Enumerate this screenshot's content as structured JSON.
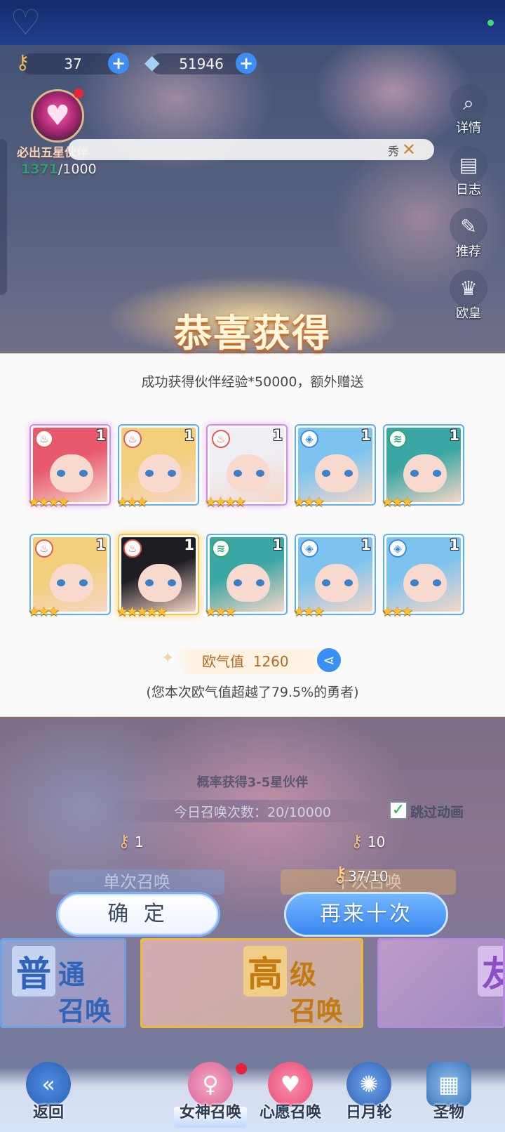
{
  "resources": {
    "keys": "37",
    "diamonds": "51946"
  },
  "pity": {
    "label": "必出五星伙伴",
    "current": "1371",
    "total": "/1000"
  },
  "marquee": {
    "text": "秀"
  },
  "side_menu": [
    {
      "label": "详情",
      "icon": "search-icon"
    },
    {
      "label": "日志",
      "icon": "book-icon"
    },
    {
      "label": "推荐",
      "icon": "feather-icon"
    },
    {
      "label": "欧皇",
      "icon": "crown-icon"
    }
  ],
  "result": {
    "title": "恭喜获得",
    "message": "成功获得伙伴经验*50000，额外赠送",
    "cards": [
      {
        "level": "1",
        "stars": 4,
        "element": "fire",
        "frame": "purple",
        "hair": "#e8596e"
      },
      {
        "level": "1",
        "stars": 3,
        "element": "fire",
        "frame": "blue",
        "hair": "#f2cf7a"
      },
      {
        "level": "1",
        "stars": 4,
        "element": "fire",
        "frame": "purple",
        "hair": "#eeeef4"
      },
      {
        "level": "1",
        "stars": 3,
        "element": "water",
        "frame": "blue",
        "hair": "#7cc4ef"
      },
      {
        "level": "1",
        "stars": 3,
        "element": "wind",
        "frame": "blue",
        "hair": "#3aa7a4"
      },
      {
        "level": "1",
        "stars": 3,
        "element": "fire",
        "frame": "blue",
        "hair": "#f2cf7a"
      },
      {
        "level": "1",
        "stars": 5,
        "element": "fire",
        "frame": "gold",
        "hair": "#1f1d24"
      },
      {
        "level": "1",
        "stars": 3,
        "element": "wind",
        "frame": "blue",
        "hair": "#3aa7a4"
      },
      {
        "level": "1",
        "stars": 3,
        "element": "water",
        "frame": "blue",
        "hair": "#7cc4ef"
      },
      {
        "level": "1",
        "stars": 3,
        "element": "water",
        "frame": "blue",
        "hair": "#7cc4ef"
      }
    ],
    "luck_label": "欧气值",
    "luck_value": "1260",
    "luck_note": "(您本次欧气值超越了79.5%的勇者)"
  },
  "summon": {
    "rate_text": "概率获得3-5星伙伴",
    "daily_text": "今日召唤次数：20/10000",
    "skip_label": "跳过动画",
    "single_cost": "1",
    "ten_cost": "10",
    "ten_available": "37/10",
    "single_label": "单次召唤",
    "ten_label": "十次召唤",
    "confirm_label": "确 定",
    "again_label": "再来十次"
  },
  "pools": {
    "normal": {
      "big": "普",
      "rest1": "通",
      "rest2": "召唤"
    },
    "high": {
      "big": "高",
      "rest1": "级",
      "rest2": "召唤"
    },
    "friend": {
      "big": "友"
    }
  },
  "bottom_nav": [
    {
      "label": "返回",
      "icon": "back-icon"
    },
    {
      "label": "女神召唤",
      "icon": "goddess-icon"
    },
    {
      "label": "心愿召唤",
      "icon": "heart-icon"
    },
    {
      "label": "日月轮",
      "icon": "wheel-icon"
    },
    {
      "label": "圣物",
      "icon": "relic-icon"
    }
  ],
  "colors": {
    "accent_blue": "#3a86f0",
    "luck_text": "#b46a20",
    "star": "#ffc22c"
  }
}
